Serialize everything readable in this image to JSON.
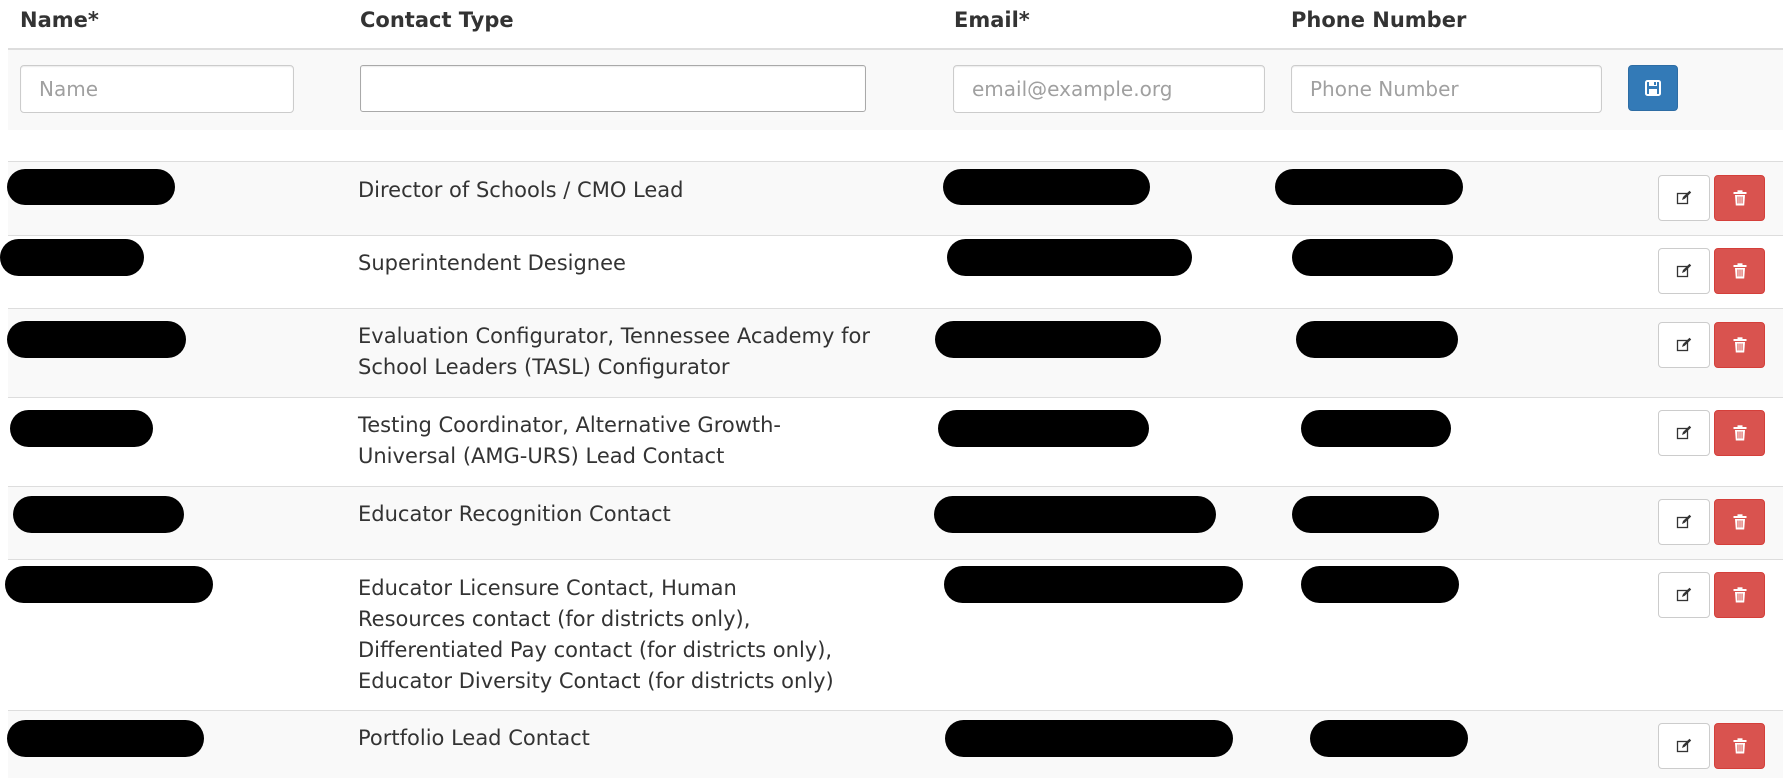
{
  "headers": {
    "name": "Name*",
    "contact_type": "Contact Type",
    "email": "Email*",
    "phone": "Phone Number"
  },
  "new_contact": {
    "name_placeholder": "Name",
    "contact_type_value": "",
    "email_placeholder": "email@example.org",
    "phone_placeholder": "Phone Number",
    "save_icon": "save-icon"
  },
  "rows": [
    {
      "contact_type": "Director of Schools / CMO Lead"
    },
    {
      "contact_type": "Superintendent Designee"
    },
    {
      "contact_type": "Evaluation Configurator, Tennessee Academy for School Leaders (TASL) Configurator"
    },
    {
      "contact_type": "Testing Coordinator, Alternative Growth-Universal (AMG-URS) Lead Contact"
    },
    {
      "contact_type": "Educator Recognition Contact"
    },
    {
      "contact_type": "Educator Licensure Contact, Human Resources contact (for districts only), Differentiated Pay contact (for districts only), Educator Diversity Contact (for districts only)"
    },
    {
      "contact_type": "Portfolio Lead Contact"
    }
  ],
  "row_actions": {
    "edit_icon": "edit-icon",
    "delete_icon": "trash-icon"
  },
  "colors": {
    "primary": "#337ab7",
    "danger": "#d9534f",
    "stripe": "#f9f9f9",
    "redaction": "#000000"
  }
}
